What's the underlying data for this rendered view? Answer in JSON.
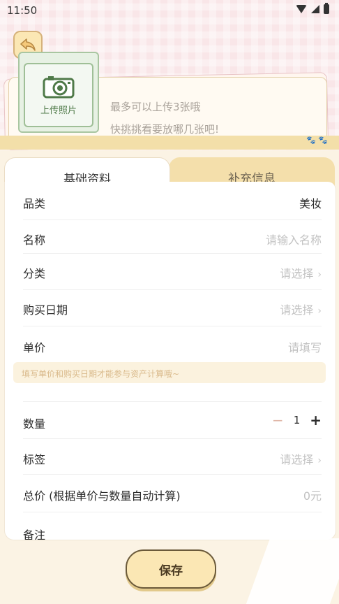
{
  "status_bar": {
    "time": "11:50"
  },
  "upload": {
    "label": "上传照片",
    "tip_line1": "最多可以上传3张哦",
    "tip_line2": "快挑挑看要放哪几张吧!"
  },
  "tabs": [
    {
      "label": "基础资料",
      "active": true
    },
    {
      "label": "补充信息",
      "active": false
    }
  ],
  "form": {
    "category_label": "品类",
    "category_value": "美妆",
    "name_label": "名称",
    "name_placeholder": "请输入名称",
    "classify_label": "分类",
    "classify_value": "请选择",
    "purchase_date_label": "购买日期",
    "purchase_date_value": "请选择",
    "unit_price_label": "单价",
    "unit_price_placeholder": "请填写",
    "hint": "填写单价和购买日期才能参与资产计算哦~",
    "quantity_label": "数量",
    "quantity_value": "1",
    "quantity_minus": "−",
    "quantity_plus": "+",
    "tags_label": "标签",
    "tags_value": "请选择",
    "total_label": "总价 (根据单价与数量自动计算)",
    "total_value": "0元",
    "remark_label": "备注"
  },
  "save_label": "保存",
  "colors": {
    "accent_yellow": "#fbe7b4",
    "photo_green": "#a9c6a1",
    "hint_text": "#d9b98a"
  },
  "icons": {
    "back": "back-arrow-icon",
    "camera": "camera-icon",
    "chevron": "chevron-right-icon"
  }
}
